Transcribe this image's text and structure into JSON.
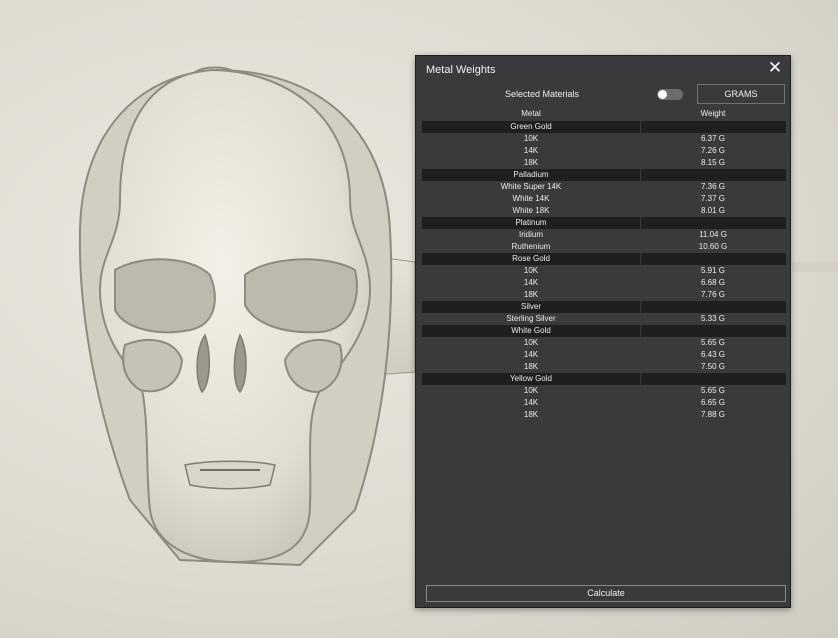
{
  "panel": {
    "title": "Metal Weights",
    "close_icon": "close-icon",
    "selected_materials_label": "Selected Materials",
    "units_button_label": "GRAMS",
    "columns": {
      "metal": "Metal",
      "weight": "Weight"
    },
    "groups": [
      {
        "name": "Green Gold",
        "items": [
          {
            "name": "10K",
            "weight": "6.37 G"
          },
          {
            "name": "14K",
            "weight": "7.26 G"
          },
          {
            "name": "18K",
            "weight": "8.15 G"
          }
        ]
      },
      {
        "name": "Palladium",
        "items": [
          {
            "name": "White Super 14K",
            "weight": "7.36 G"
          },
          {
            "name": "White 14K",
            "weight": "7.37 G"
          },
          {
            "name": "White 18K",
            "weight": "8.01 G"
          }
        ]
      },
      {
        "name": "Platinum",
        "items": [
          {
            "name": "Iridium",
            "weight": "11.04 G"
          },
          {
            "name": "Ruthenium",
            "weight": "10.60 G"
          }
        ]
      },
      {
        "name": "Rose Gold",
        "items": [
          {
            "name": "10K",
            "weight": "5.91 G"
          },
          {
            "name": "14K",
            "weight": "6.68 G"
          },
          {
            "name": "18K",
            "weight": "7.76 G"
          }
        ]
      },
      {
        "name": "Silver",
        "items": [
          {
            "name": "Sterling Silver",
            "weight": "5.33 G"
          }
        ]
      },
      {
        "name": "White Gold",
        "items": [
          {
            "name": "10K",
            "weight": "5.65 G"
          },
          {
            "name": "14K",
            "weight": "6.43 G"
          },
          {
            "name": "18K",
            "weight": "7.50 G"
          }
        ]
      },
      {
        "name": "Yellow Gold",
        "items": [
          {
            "name": "10K",
            "weight": "5.65 G"
          },
          {
            "name": "14K",
            "weight": "6.65 G"
          },
          {
            "name": "18K",
            "weight": "7.88 G"
          }
        ]
      }
    ],
    "calculate_label": "Calculate"
  },
  "viewport": {
    "model": "skull-ring-model"
  }
}
